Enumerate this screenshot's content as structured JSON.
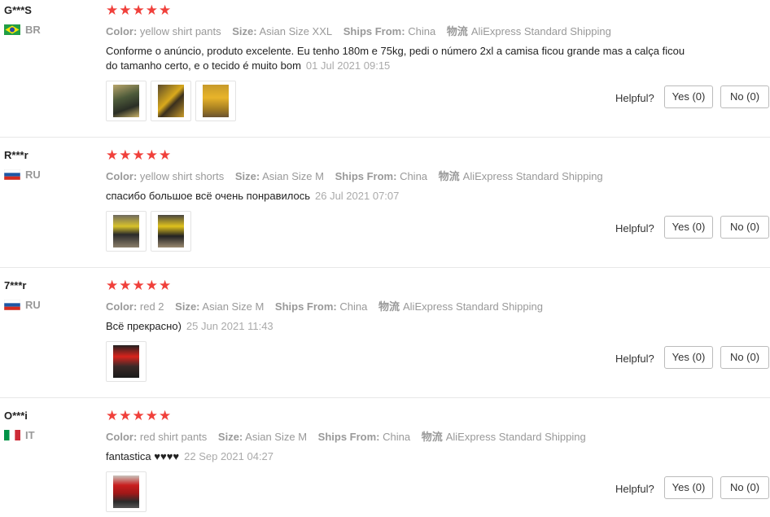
{
  "labels": {
    "color": "Color:",
    "size": "Size:",
    "ships_from": "Ships From:",
    "logistics": "物流",
    "helpful": "Helpful?",
    "yes": "Yes (0)",
    "no": "No (0)"
  },
  "star_icon": "★",
  "reviews": [
    {
      "user": "G***S",
      "country": "BR",
      "stars": 5,
      "color": "yellow shirt pants",
      "size": "Asian Size XXL",
      "ships_from": "China",
      "shipping": "AliExpress Standard Shipping",
      "text": "Conforme o anúncio, produto excelente. Eu tenho 180m e 75kg, pedi o número 2xl a camisa ficou grande mas a calça ficou do tamanho certo, e o tecido é muito bom",
      "date": "01 Jul 2021 09:15",
      "photos": 3
    },
    {
      "user": "R***r",
      "country": "RU",
      "stars": 5,
      "color": "yellow shirt shorts",
      "size": "Asian Size M",
      "ships_from": "China",
      "shipping": "AliExpress Standard Shipping",
      "text": "спасибо большое всё очень понравилось",
      "date": "26 Jul 2021 07:07",
      "photos": 2
    },
    {
      "user": "7***r",
      "country": "RU",
      "stars": 5,
      "color": "red 2",
      "size": "Asian Size M",
      "ships_from": "China",
      "shipping": "AliExpress Standard Shipping",
      "text": "Всё прекрасно)",
      "date": "25 Jun 2021 11:43",
      "photos": 1
    },
    {
      "user": "O***i",
      "country": "IT",
      "stars": 5,
      "color": "red shirt pants",
      "size": "Asian Size M",
      "ships_from": "China",
      "shipping": "AliExpress Standard Shipping",
      "text": "fantastica ♥♥♥♥",
      "date": "22 Sep 2021 04:27",
      "photos": 1
    }
  ]
}
